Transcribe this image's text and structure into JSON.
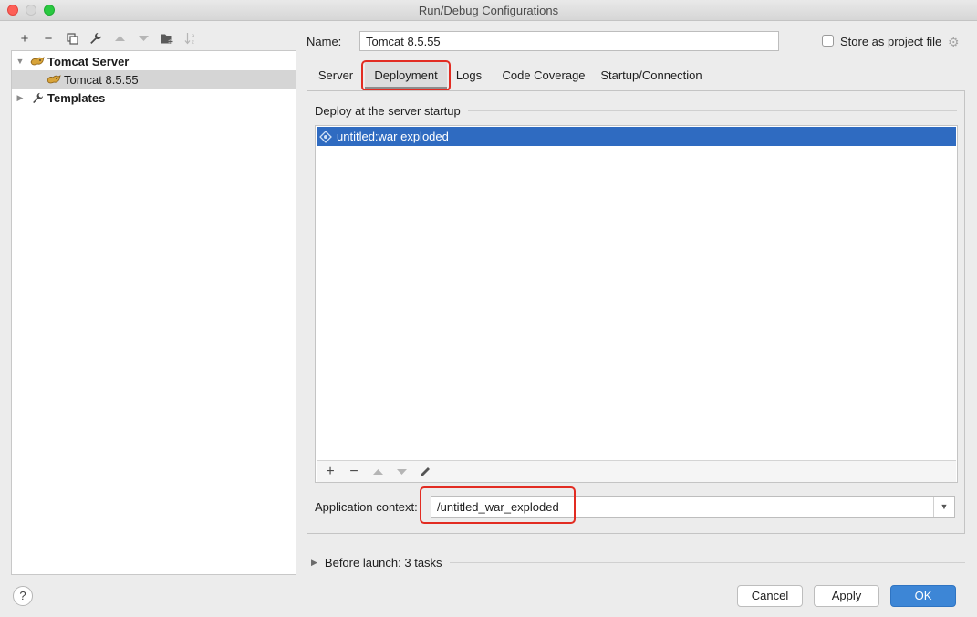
{
  "window": {
    "title": "Run/Debug Configurations"
  },
  "left_toolbar": {
    "icons": [
      "add-icon",
      "remove-icon",
      "copy-icon",
      "wrench-icon",
      "move-up-icon",
      "move-down-icon",
      "new-folder-icon",
      "sort-icon"
    ],
    "add_glyph": "+",
    "remove_glyph": "−"
  },
  "tree": {
    "items": [
      {
        "label": "Tomcat Server",
        "expanded": true
      },
      {
        "label": "Tomcat 8.5.55",
        "selected": true
      },
      {
        "label": "Templates",
        "expanded": false
      }
    ]
  },
  "name_field": {
    "label": "Name:",
    "value": "Tomcat 8.5.55"
  },
  "store": {
    "label": "Store as project file",
    "checked": false
  },
  "tabs": [
    {
      "label": "Server"
    },
    {
      "label": "Deployment",
      "active": true
    },
    {
      "label": "Logs"
    },
    {
      "label": "Code Coverage"
    },
    {
      "label": "Startup/Connection"
    }
  ],
  "deployment": {
    "section_title": "Deploy at the server startup",
    "items": [
      {
        "label": "untitled:war exploded",
        "selected": true
      }
    ],
    "list_toolbar": {
      "add_glyph": "+",
      "remove_glyph": "−"
    },
    "context_label": "Application context:",
    "context_value": "/untitled_war_exploded"
  },
  "before_launch": {
    "label": "Before launch: 3 tasks",
    "expanded": false
  },
  "buttons": {
    "help": "?",
    "cancel": "Cancel",
    "apply": "Apply",
    "ok": "OK"
  },
  "colors": {
    "highlight": "#e22c22",
    "selection": "#2f6bc1",
    "primary": "#3d86d6"
  }
}
